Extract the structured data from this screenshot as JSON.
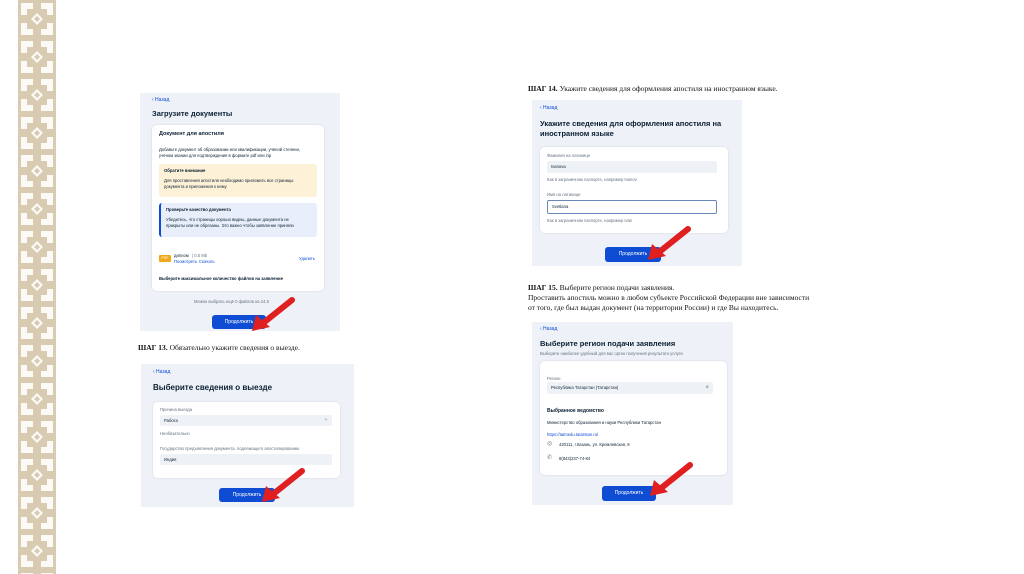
{
  "colors": {
    "accent": "#0d4cd3",
    "arrow": "#e02020",
    "page_bg": "#eef2f8",
    "warning_bg": "#fdf1d7",
    "info_bg": "#e9effa"
  },
  "common": {
    "back": "‹ Назад",
    "continue": "Продолжить"
  },
  "step13": {
    "label": "ШАГ 13.",
    "text": "Обязательно укажите сведения о выезде."
  },
  "step14": {
    "label": "ШАГ 14.",
    "text": "Укажите сведения для оформления апостиля на иностранном языке."
  },
  "step15": {
    "label": "ШАГ 15.",
    "text": "Выберите регион подачи заявления.",
    "line2": "Проставить апостиль можно в любом субъекте Российской Федерации вне зависимости",
    "line3": "от того, где был выдан документ (на территории России) и где Вы находитесь."
  },
  "upload": {
    "title": "Загрузите документы",
    "card_title": "Документ для апостиля",
    "desc1": "Добавьте документ об образовании или квалификации, учёной степени,",
    "desc2": "учёном звании для подтверждения в формате pdf или zip",
    "warn_title": "Обратите внимание",
    "warn_text1": "Для проставления апостиля необходимо приложить все страницы",
    "warn_text2": "документа и приложения к нему",
    "info_title": "Проверьте качество документа",
    "info_text1": "Убедитесь, что страницы хорошо видны, данные документа не",
    "info_text2": "прикрыты или не обрезаны. Это важно чтобы заявление приняли",
    "file_badge": "PDF",
    "file_name": "диплом",
    "file_size": "| 0.5 Mb",
    "file_view": "Посмотреть",
    "file_download": "Скачать",
    "file_delete": "Удалить",
    "max_files": "Выберите максимальное количество файлов на заявление",
    "remaining": "Можно выбрать ещё 0 файлов на 24.5"
  },
  "departure": {
    "title": "Выберите сведения о выезде",
    "reason_label": "Причина выезда",
    "reason_value": "Работа",
    "optional": "Необязательно",
    "country_label": "Государство предъявления документа, подлежащего апостилированию",
    "country_value": "Индия"
  },
  "foreign": {
    "title1": "Укажите сведения для оформления апостиля на",
    "title2": "иностранном языке",
    "surname_label": "Фамилия на латинице",
    "surname_value": "Ivanova",
    "surname_hint": "Как в заграничном паспорте, например Ivanov",
    "name_label": "Имя на латинице",
    "name_value": "Svetlana",
    "name_hint": "Как в заграничном паспорте, например Ivan"
  },
  "region": {
    "title": "Выберите регион подачи заявления",
    "subtitle": "Выберите наиболее удобный для вас орган получения результата услуги",
    "region_label": "Регион",
    "region_value": "Республика Татарстан (Татарстан)",
    "dept_title": "Выбранное ведомство",
    "dept_name": "Министерство образования и науки Республики Татарстан",
    "dept_url": "https://tatmedu.tatarstan.ru/",
    "address": "420111, г.Казань, ул. Кремлевская, 9",
    "phone": "8(843)237-74-84"
  }
}
